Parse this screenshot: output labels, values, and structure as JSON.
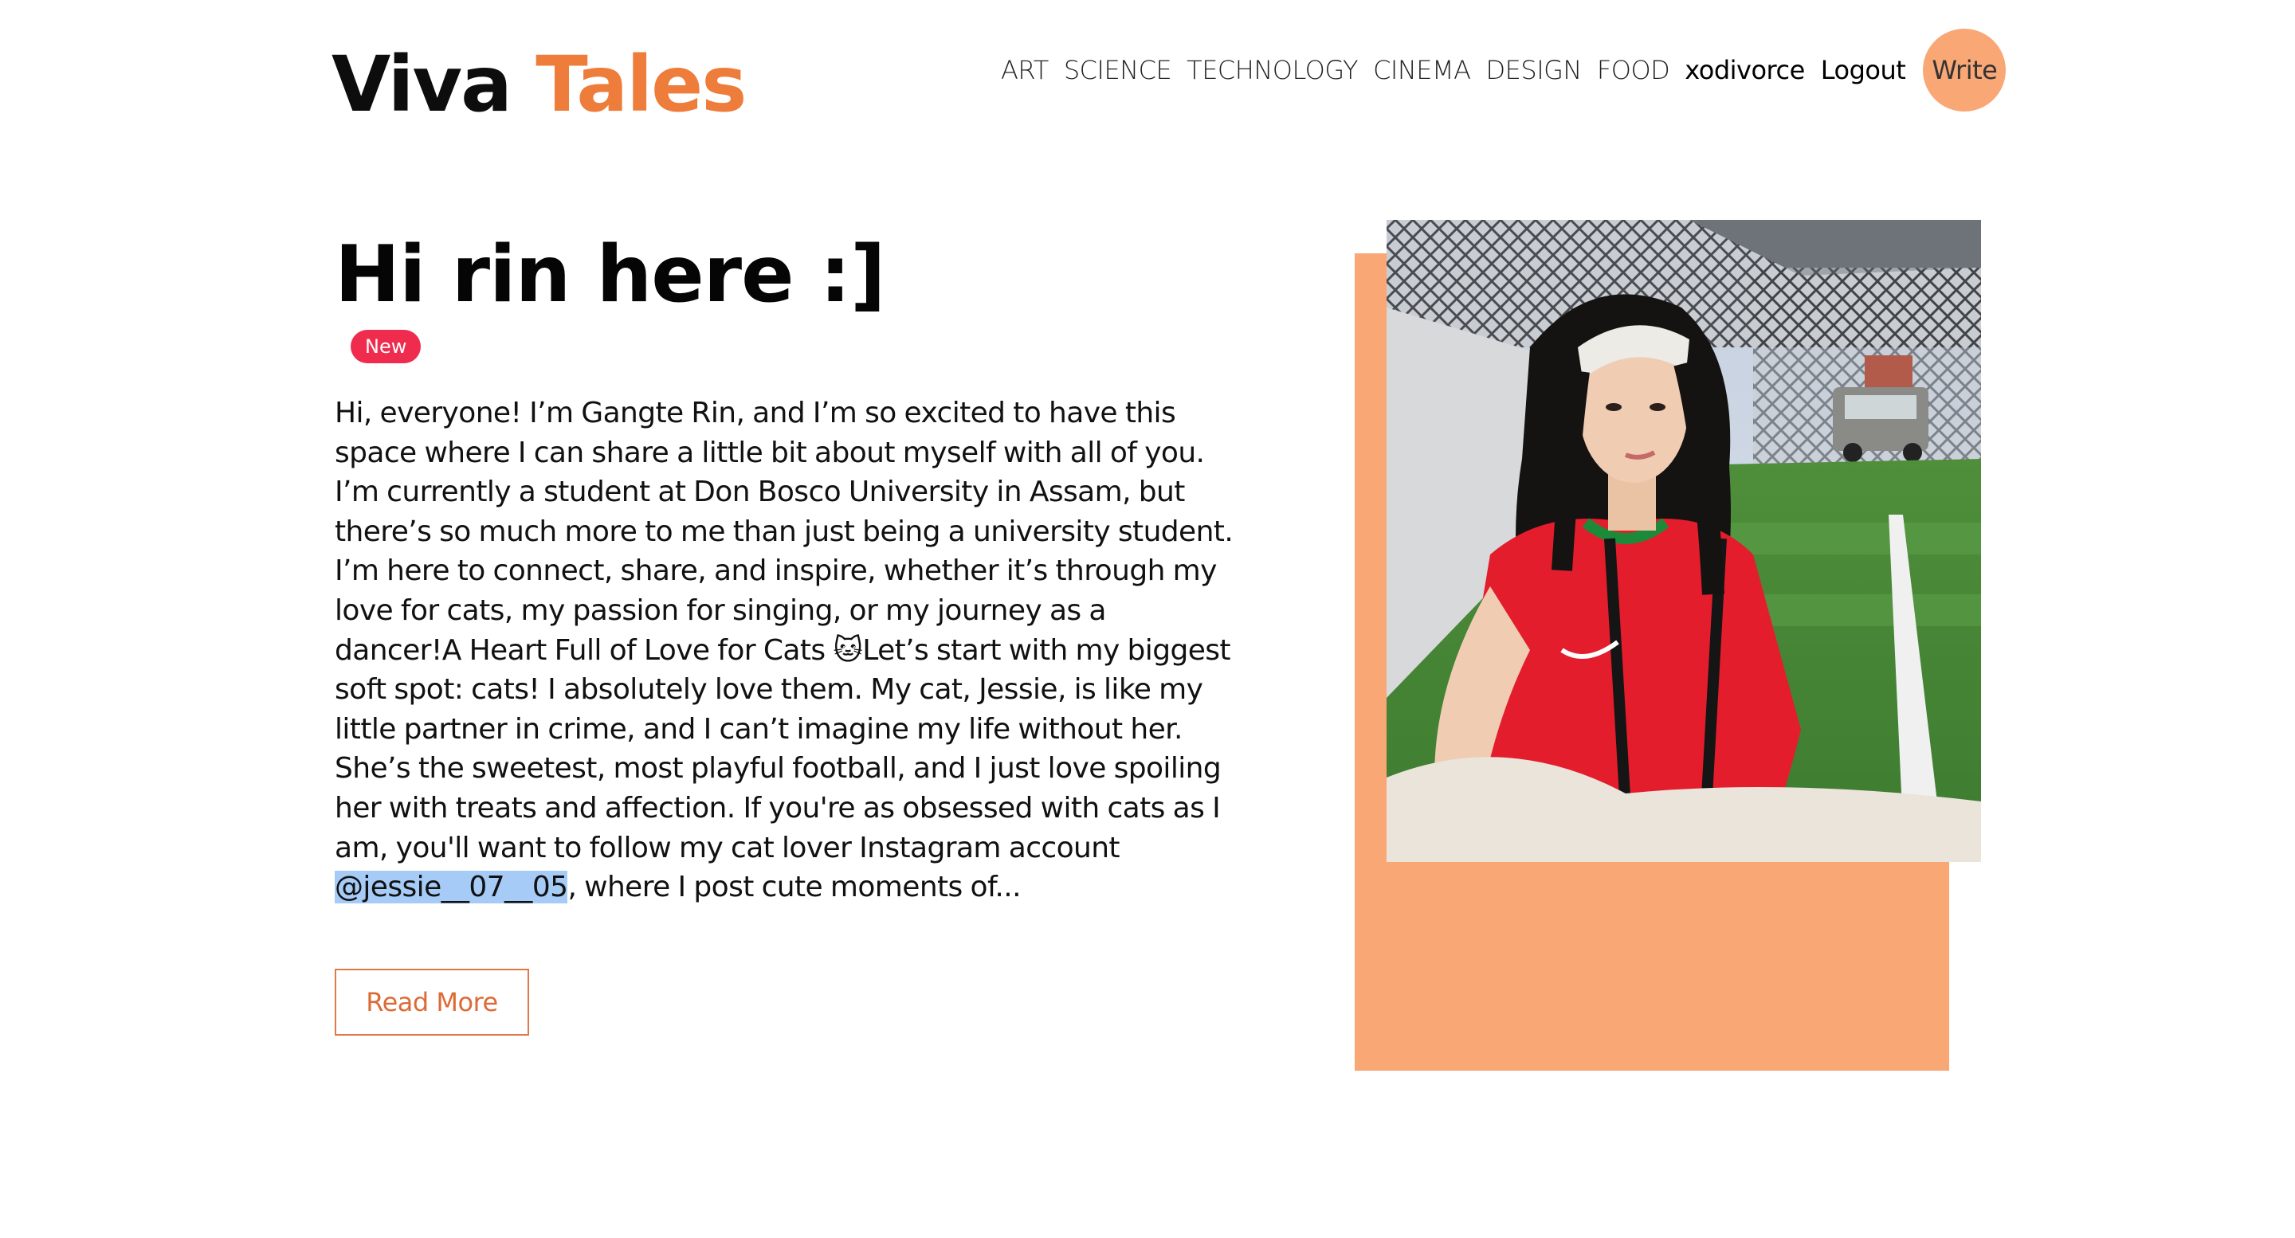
{
  "header": {
    "logo_part1": "Viva",
    "logo_part2": "Tales",
    "nav": {
      "categories": [
        "ART",
        "SCIENCE",
        "TECHNOLOGY",
        "CINEMA",
        "DESIGN",
        "FOOD"
      ],
      "username": "xodivorce",
      "logout": "Logout",
      "write": "Write"
    }
  },
  "post": {
    "title": "Hi rin here :]",
    "badge": "New",
    "body_before_mention": "Hi, everyone! I’m Gangte Rin, and I’m so excited to have this space where I can share a little bit about myself with all of you. I’m currently a student at Don Bosco University in Assam, but there’s so much more to me than just being a university student. I’m here to connect, share, and inspire, whether it’s through my love for cats, my passion for singing, or my journey as a dancer!A Heart Full of Love for Cats 🐱Let’s start with my biggest soft spot: cats! I absolutely love them. My cat, Jessie, is like my little partner in crime, and I can’t imagine my life without her. She’s the sweetest, most playful football, and I just love spoiling her with treats and affection. If you're as obsessed with cats as I am, you'll want to follow my cat lover Instagram account ",
    "mention": "@jessie__07__05",
    "body_after_mention": ", where I post cute moments of...",
    "read_more": "Read More"
  },
  "colors": {
    "accent": "#ee7d3b",
    "write_button": "#f8a775",
    "image_backdrop": "#f8a775",
    "badge": "#ef2b4e",
    "mention_highlight": "#a6cbf7"
  }
}
